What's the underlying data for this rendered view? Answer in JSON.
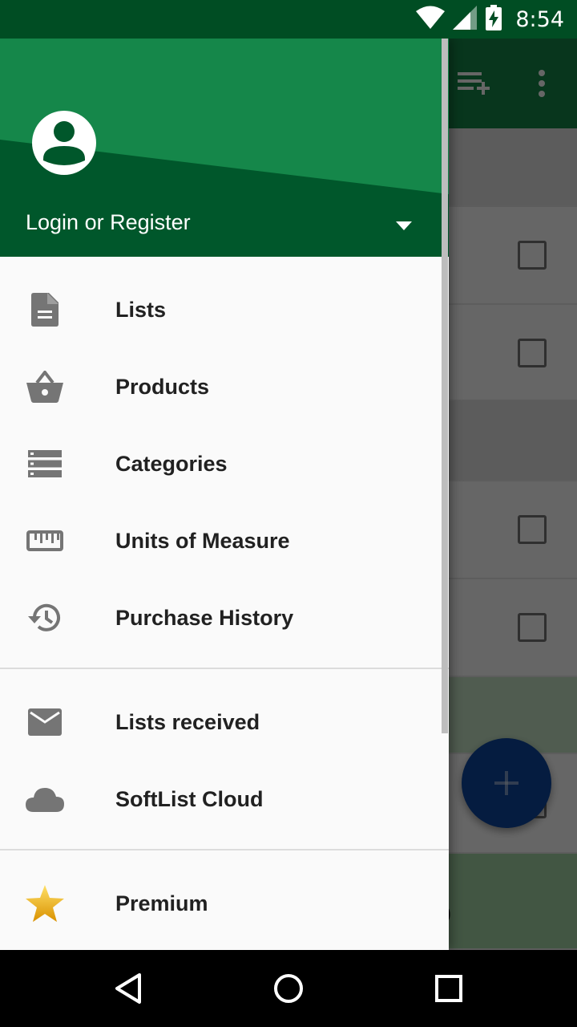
{
  "status_bar": {
    "time": "8:54",
    "icons": [
      "wifi-icon",
      "cell-signal-icon",
      "battery-charging-icon"
    ]
  },
  "background_app": {
    "toolbar_icons": [
      "playlist-add-icon",
      "more-vert-icon"
    ],
    "fab_icon": "add-icon",
    "partial_text": "0"
  },
  "drawer": {
    "header": {
      "avatar_icon": "account-circle-icon",
      "account_label": "Login or Register",
      "dropdown_icon": "arrow-drop-down-icon",
      "colors": {
        "light": "#15874a",
        "dark": "#00572b"
      }
    },
    "items": [
      {
        "label": "Lists",
        "icon": "document-icon"
      },
      {
        "label": "Products",
        "icon": "basket-icon"
      },
      {
        "label": "Categories",
        "icon": "categories-icon"
      },
      {
        "label": "Units of Measure",
        "icon": "ruler-icon"
      },
      {
        "label": "Purchase History",
        "icon": "history-icon"
      },
      {
        "label": "Lists received",
        "icon": "mail-icon"
      },
      {
        "label": "SoftList Cloud",
        "icon": "cloud-icon"
      },
      {
        "label": "Premium",
        "icon": "star-icon"
      }
    ]
  },
  "nav_bar": {
    "buttons": [
      "back-icon",
      "home-icon",
      "recents-icon"
    ]
  },
  "colors": {
    "status_bar": "#004d23",
    "primary": "#15874a",
    "fab": "#0d47a1",
    "icon_gray": "#757575",
    "star": "#f4b400"
  }
}
